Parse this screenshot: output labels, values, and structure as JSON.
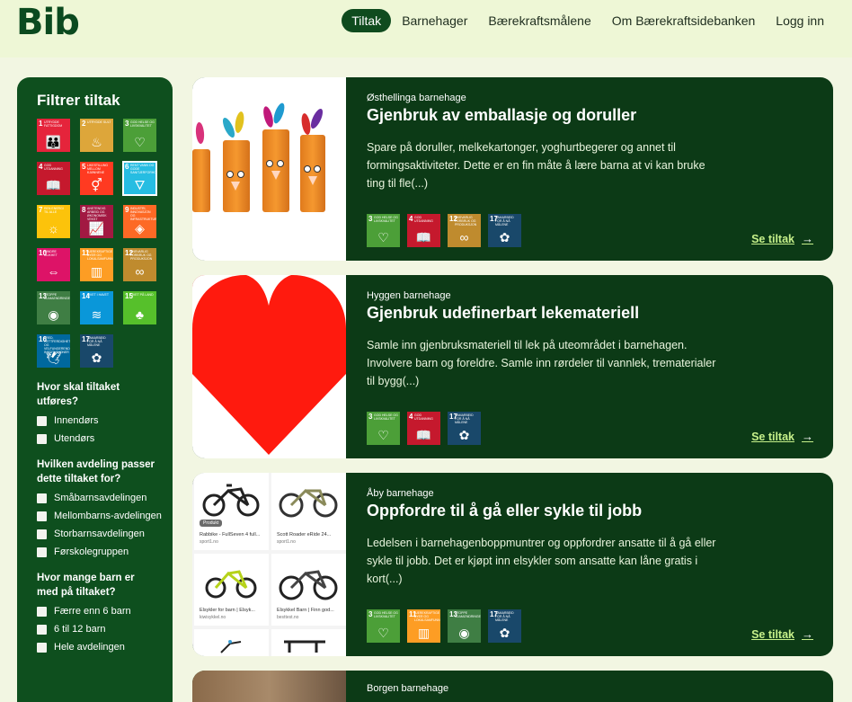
{
  "logo": "Bib",
  "nav": [
    "Tiltak",
    "Barnehager",
    "Bærekraftsmålene",
    "Om Bærekraftsidebanken",
    "Logg inn"
  ],
  "nav_active": "Tiltak",
  "sidebar": {
    "title": "Filtrer tiltak",
    "goals": [
      {
        "n": "1",
        "t": "Utrydde fattigdom",
        "color": "#e5243b",
        "icon": "family-icon",
        "glyph": "👪"
      },
      {
        "n": "2",
        "t": "Utrydde sult",
        "color": "#dda63a",
        "icon": "bowl-icon",
        "glyph": "♨"
      },
      {
        "n": "3",
        "t": "God helse og livskvalitet",
        "color": "#4c9f38",
        "icon": "heartbeat-icon",
        "glyph": "♡"
      },
      {
        "n": "4",
        "t": "God utdanning",
        "color": "#c5192d",
        "icon": "book-icon",
        "glyph": "📖"
      },
      {
        "n": "5",
        "t": "Likestilling mellom kjønnene",
        "color": "#ff3a21",
        "icon": "gender-icon",
        "glyph": "⚥"
      },
      {
        "n": "6",
        "t": "Rent vann og gode sanitærforhold",
        "color": "#26bde2",
        "icon": "water-icon",
        "glyph": "🜄"
      },
      {
        "n": "7",
        "t": "Ren energi til alle",
        "color": "#fcc30b",
        "icon": "sun-icon",
        "glyph": "☼"
      },
      {
        "n": "8",
        "t": "Anstendig arbeid og økonomisk vekst",
        "color": "#a21942",
        "icon": "growth-icon",
        "glyph": "📈"
      },
      {
        "n": "9",
        "t": "Industri, innovasjon og infrastruktur",
        "color": "#fd6925",
        "icon": "cubes-icon",
        "glyph": "◈"
      },
      {
        "n": "10",
        "t": "Mindre ulikhet",
        "color": "#dd1367",
        "icon": "equality-icon",
        "glyph": "⇔"
      },
      {
        "n": "11",
        "t": "Bærekraftige byer og lokalsamfunn",
        "color": "#fd9d24",
        "icon": "city-icon",
        "glyph": "▥"
      },
      {
        "n": "12",
        "t": "Ansvarlig forbruk og produksjon",
        "color": "#bf8b2e",
        "icon": "infinity-icon",
        "glyph": "∞"
      },
      {
        "n": "13",
        "t": "Stoppe klimaendringene",
        "color": "#3f7e44",
        "icon": "eye-globe-icon",
        "glyph": "◉"
      },
      {
        "n": "14",
        "t": "Livet i havet",
        "color": "#0a97d9",
        "icon": "fish-icon",
        "glyph": "≋"
      },
      {
        "n": "15",
        "t": "Livet på land",
        "color": "#56c02b",
        "icon": "tree-icon",
        "glyph": "♣"
      },
      {
        "n": "16",
        "t": "Fred, rettferdighet og velfungerende institusjoner",
        "color": "#00689d",
        "icon": "dove-icon",
        "glyph": "🕊"
      },
      {
        "n": "17",
        "t": "Samarbeid for å nå målene",
        "color": "#19486a",
        "icon": "flower-icon",
        "glyph": "✿"
      }
    ],
    "selected_goal": "6",
    "filters": [
      {
        "question": "Hvor skal tiltaket utføres?",
        "options": [
          "Innendørs",
          "Utendørs"
        ]
      },
      {
        "question": "Hvilken avdeling passer dette tiltaket for?",
        "options": [
          "Småbarnsavdelingen",
          "Mellombarns-avdelingen",
          "Storbarnsavdelingen",
          "Førskolegruppen"
        ]
      },
      {
        "question": "Hvor mange barn er med på tiltaket?",
        "options": [
          "Færre enn 6 barn",
          "6 til 12 barn",
          "Hele avdelingen"
        ]
      }
    ]
  },
  "cards": [
    {
      "kindergarten": "Østhellinga barnehage",
      "title": "Gjenbruk av emballasje og doruller",
      "description": "Spare på doruller, melkekartonger, yoghurtbegerer og annet til formingsaktiviteter. Dette er en fin måte å lære barna at vi kan bruke ting til fle(...)",
      "goals": [
        "3",
        "4",
        "12",
        "17"
      ],
      "link": "Se tiltak"
    },
    {
      "kindergarten": "Hyggen barnehage",
      "title": "Gjenbruk udefinerbart lekemateriell",
      "description": "Samle inn gjenbruksmateriell til lek på uteområdet i barnehagen. Involvere barn og foreldre. Samle inn rørdeler til vannlek, trematerialer til bygg(...)",
      "goals": [
        "3",
        "4",
        "17"
      ],
      "link": "Se tiltak"
    },
    {
      "kindergarten": "Åby barnehage",
      "title": "Oppfordre til å gå eller sykle til jobb",
      "description": "Ledelsen i barnehagenboppmuntrer og oppfordrer ansatte til å gå eller sykle til jobb. Det er kjøpt inn elsykler som ansatte kan låne gratis i kort(...)",
      "goals": [
        "3",
        "11",
        "13",
        "17"
      ],
      "link": "Se tiltak",
      "image_tiles": [
        {
          "label": "Rabbike - FullSeven 4 full...",
          "source": "sport1.no",
          "badge": "Produkt"
        },
        {
          "label": "Scott Roader eRide 24...",
          "source": "sport1.no"
        },
        {
          "label": "Elsykler for barn | Elsyk...",
          "source": "kiwisykkel.no"
        },
        {
          "label": "Elsykkel Barn | Finn god...",
          "source": "besttest.no"
        }
      ]
    },
    {
      "kindergarten": "Borgen barnehage",
      "title": "",
      "description": "",
      "goals": [],
      "link": ""
    }
  ]
}
